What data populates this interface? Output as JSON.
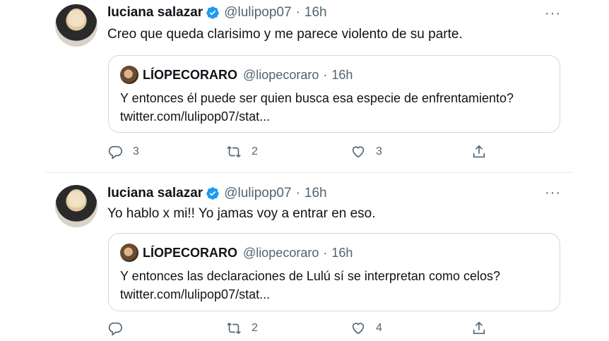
{
  "tweets": [
    {
      "author": {
        "name": "luciana salazar",
        "handle": "@lulipop07",
        "time": "16h"
      },
      "text": "Creo que queda clarisimo y me parece violento de su parte.",
      "more": "···",
      "quote": {
        "name": "LÍOPECORARO",
        "handle": "@liopecoraro",
        "time": "16h",
        "line1": "Y entonces él puede ser quien busca esa especie de enfrentamiento?",
        "line2": "twitter.com/lulipop07/stat..."
      },
      "actions": {
        "replies": "3",
        "retweets": "2",
        "likes": "3"
      }
    },
    {
      "author": {
        "name": "luciana salazar",
        "handle": "@lulipop07",
        "time": "16h"
      },
      "text": "Yo hablo x mi!! Yo jamas voy a entrar en eso.",
      "more": "···",
      "quote": {
        "name": "LÍOPECORARO",
        "handle": "@liopecoraro",
        "time": "16h",
        "line1": "Y entonces las declaraciones de Lulú sí se interpretan como celos?",
        "line2": "twitter.com/lulipop07/stat..."
      },
      "actions": {
        "replies": "",
        "retweets": "2",
        "likes": "4"
      }
    }
  ],
  "separator": "·",
  "colors": {
    "verified": "#1d9bf0",
    "muted": "#536471",
    "text": "#0f1419",
    "border": "#cfd9de"
  },
  "icons": [
    "verified-badge-icon",
    "more-icon",
    "reply-icon",
    "retweet-icon",
    "like-icon",
    "share-icon"
  ]
}
